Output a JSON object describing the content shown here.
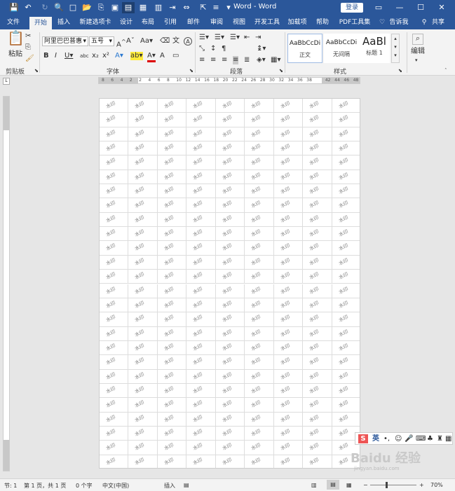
{
  "window": {
    "title": "Word - Word",
    "login": "登录"
  },
  "tabs": [
    "文件",
    "开始",
    "插入",
    "新建选项卡",
    "设计",
    "布局",
    "引用",
    "邮件",
    "审阅",
    "视图",
    "开发工具",
    "加载项",
    "帮助",
    "PDF工具集",
    "告诉我",
    "共享"
  ],
  "ribbon": {
    "clipboard": {
      "paste": "粘贴",
      "label": "剪贴板"
    },
    "font": {
      "name": "阿里巴巴普惠",
      "size": "五号",
      "label": "字体"
    },
    "paragraph": {
      "label": "段落"
    },
    "styles": {
      "label": "样式",
      "items": [
        {
          "preview": "AaBbCcDi",
          "name": "正文"
        },
        {
          "preview": "AaBbCcDi",
          "name": "无间隔"
        },
        {
          "preview": "AaBl",
          "name": "标题 1"
        }
      ]
    },
    "edit": {
      "label": "编辑"
    }
  },
  "ruler": {
    "ticks": [
      "8",
      "6",
      "4",
      "2",
      "2",
      "4",
      "6",
      "8",
      "10",
      "12",
      "14",
      "16",
      "18",
      "20",
      "22",
      "24",
      "26",
      "28",
      "30",
      "32",
      "34",
      "36",
      "38",
      "42",
      "44",
      "46",
      "48"
    ]
  },
  "document": {
    "cell_text": "水印",
    "columns": 9,
    "rows": 26
  },
  "statusbar": {
    "section": "节: 1",
    "page": "第 1 页，共 1 页",
    "words": "0 个字",
    "language": "中文(中国)",
    "mode": "插入",
    "zoom": "70%"
  },
  "ime": {
    "label": "英"
  },
  "watermark": {
    "brand": "Baidu 经验",
    "url": "jingyan.baidu.com"
  }
}
